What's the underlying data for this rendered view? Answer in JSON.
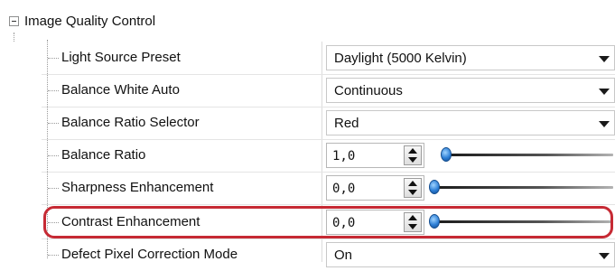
{
  "category": {
    "title": "Image Quality Control",
    "expander_icon": "collapse-minus-icon"
  },
  "properties": [
    {
      "name": "Light Source Preset",
      "control": "combo",
      "value": "Daylight (5000 Kelvin)"
    },
    {
      "name": "Balance White Auto",
      "control": "combo",
      "value": "Continuous"
    },
    {
      "name": "Balance Ratio Selector",
      "control": "combo",
      "value": "Red"
    },
    {
      "name": "Balance Ratio",
      "control": "spinslider",
      "value": "1,0"
    },
    {
      "name": "Sharpness Enhancement",
      "control": "spinslider",
      "value": "0,0"
    },
    {
      "name": "Contrast Enhancement",
      "control": "spinslider",
      "value": "0,0",
      "highlighted": true
    },
    {
      "name": "Defect Pixel Correction Mode",
      "control": "combo",
      "value": "On"
    }
  ],
  "colors": {
    "highlight": "#c62a34",
    "slider_thumb": "#2d7fd6"
  }
}
